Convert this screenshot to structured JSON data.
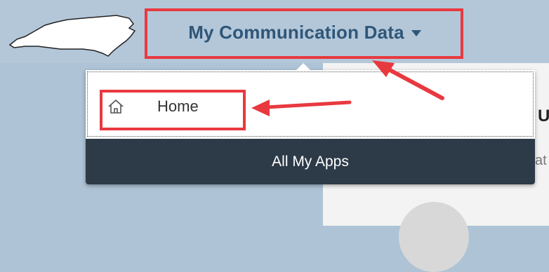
{
  "header": {
    "app_title": "My Communication Data",
    "dropdown_indicator": "caret-down-icon"
  },
  "menu": {
    "items": [
      {
        "label": "Home",
        "icon": "home-icon"
      }
    ],
    "all_apps_label": "All My Apps"
  },
  "background_panel": {
    "partial_heading": "U",
    "partial_text": "at"
  },
  "colors": {
    "title": "#2f5678",
    "highlight": "#e8393f",
    "footer_bar": "#2d3a48",
    "header_bg": "#b3c7d9"
  }
}
